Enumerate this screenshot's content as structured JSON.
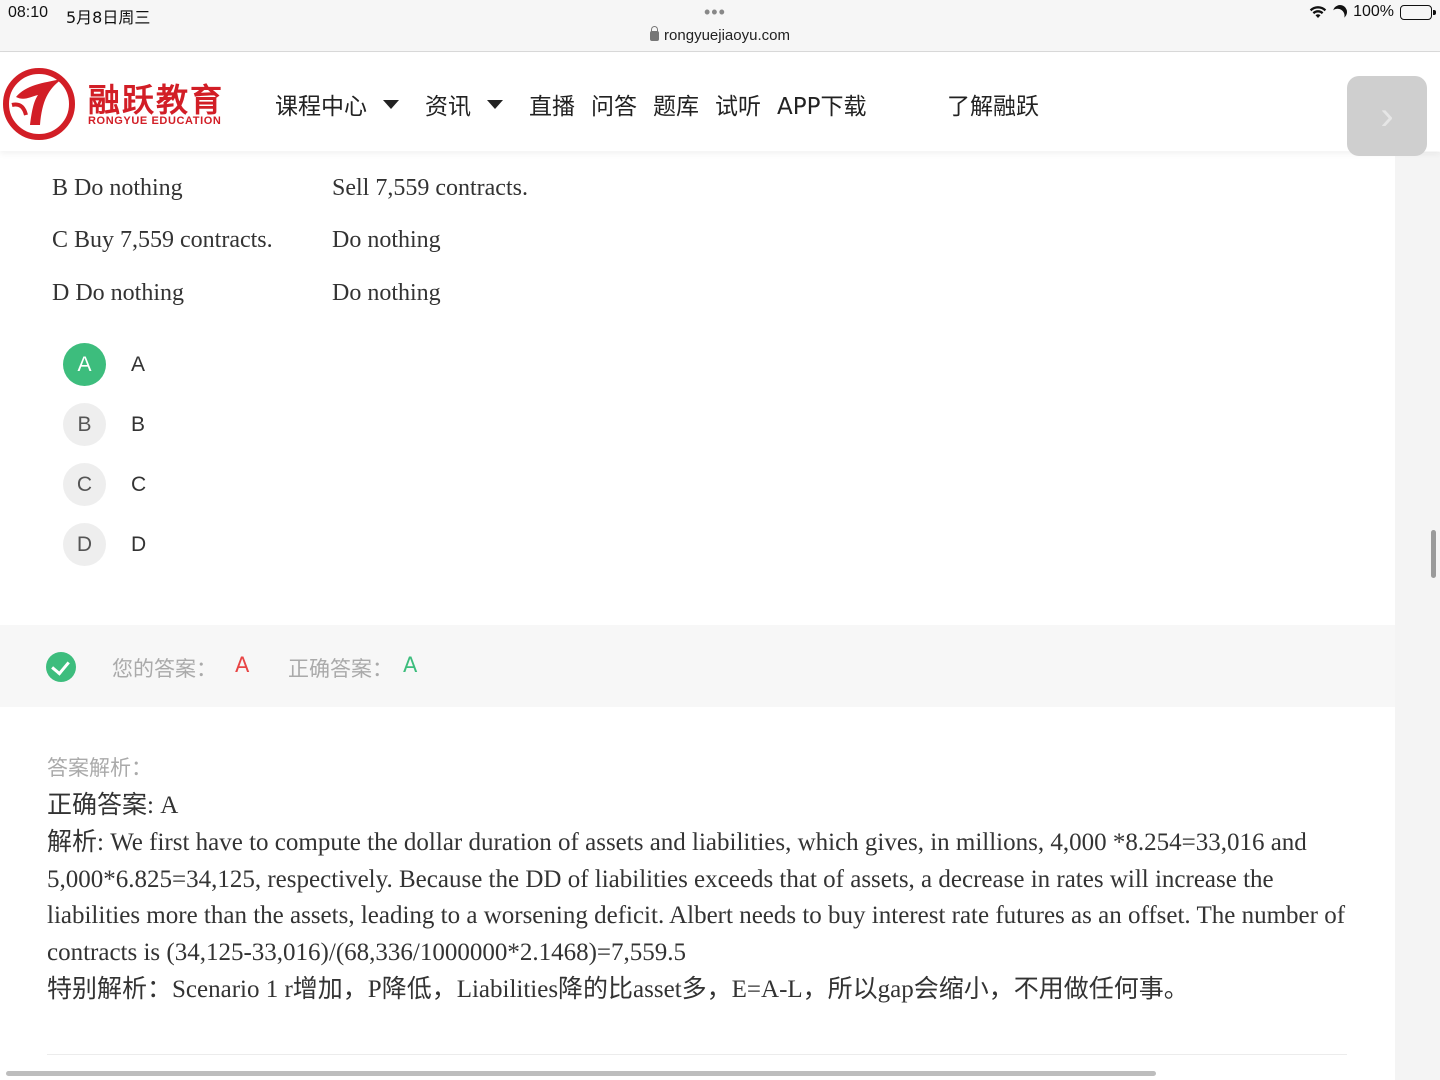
{
  "status_bar": {
    "time": "08:10",
    "date": "5月8日周三",
    "dots": "•••",
    "url": "rongyuejiaoyu.com",
    "battery": "100%"
  },
  "site": {
    "logo_cn": "融跃教育",
    "logo_en": "RONGYUE EDUCATION",
    "brand_color": "#d21e26",
    "nav": [
      {
        "label": "课程中心",
        "has_dropdown": true
      },
      {
        "label": "资讯",
        "has_dropdown": true
      },
      {
        "label": "直播",
        "has_dropdown": false
      },
      {
        "label": "问答",
        "has_dropdown": false
      },
      {
        "label": "题库",
        "has_dropdown": false
      },
      {
        "label": "试听",
        "has_dropdown": false
      },
      {
        "label": "APP下载",
        "has_dropdown": false
      }
    ],
    "about": "了解融跃",
    "next_icon": "chevron-right-icon"
  },
  "options_table": [
    {
      "col1": "B Do nothing",
      "col2": "Sell 7,559 contracts."
    },
    {
      "col1": "C Buy 7,559 contracts.",
      "col2": "Do nothing"
    },
    {
      "col1": "D Do nothing",
      "col2": "Do nothing"
    }
  ],
  "choices": [
    {
      "letter": "A",
      "label": "A",
      "selected": true
    },
    {
      "letter": "B",
      "label": "B",
      "selected": false
    },
    {
      "letter": "C",
      "label": "C",
      "selected": false
    },
    {
      "letter": "D",
      "label": "D",
      "selected": false
    }
  ],
  "result": {
    "your_answer_label": "您的答案：",
    "your_answer": "A",
    "correct_answer_label": "正确答案：",
    "correct_answer": "A",
    "accent_green": "#3dbd7d",
    "accent_red": "#e84545"
  },
  "analysis": {
    "title": "答案解析：",
    "lines": [
      "正确答案: A",
      "解析: We first have to compute the dollar duration of assets and liabilities, which gives, in millions, 4,000 *8.254=33,016 and 5,000*6.825=34,125, respectively. Because the DD of liabilities exceeds that of assets, a decrease in rates will increase the liabilities more than the assets, leading to a worsening deficit. Albert needs to buy interest rate futures as an offset. The number of contracts is (34,125-33,016)/(68,336/1000000*2.1468)=7,559.5",
      "特别解析：Scenario 1 r增加，P降低，Liabilities降的比asset多，E=A-L，所以gap会缩小，不用做任何事。"
    ]
  }
}
